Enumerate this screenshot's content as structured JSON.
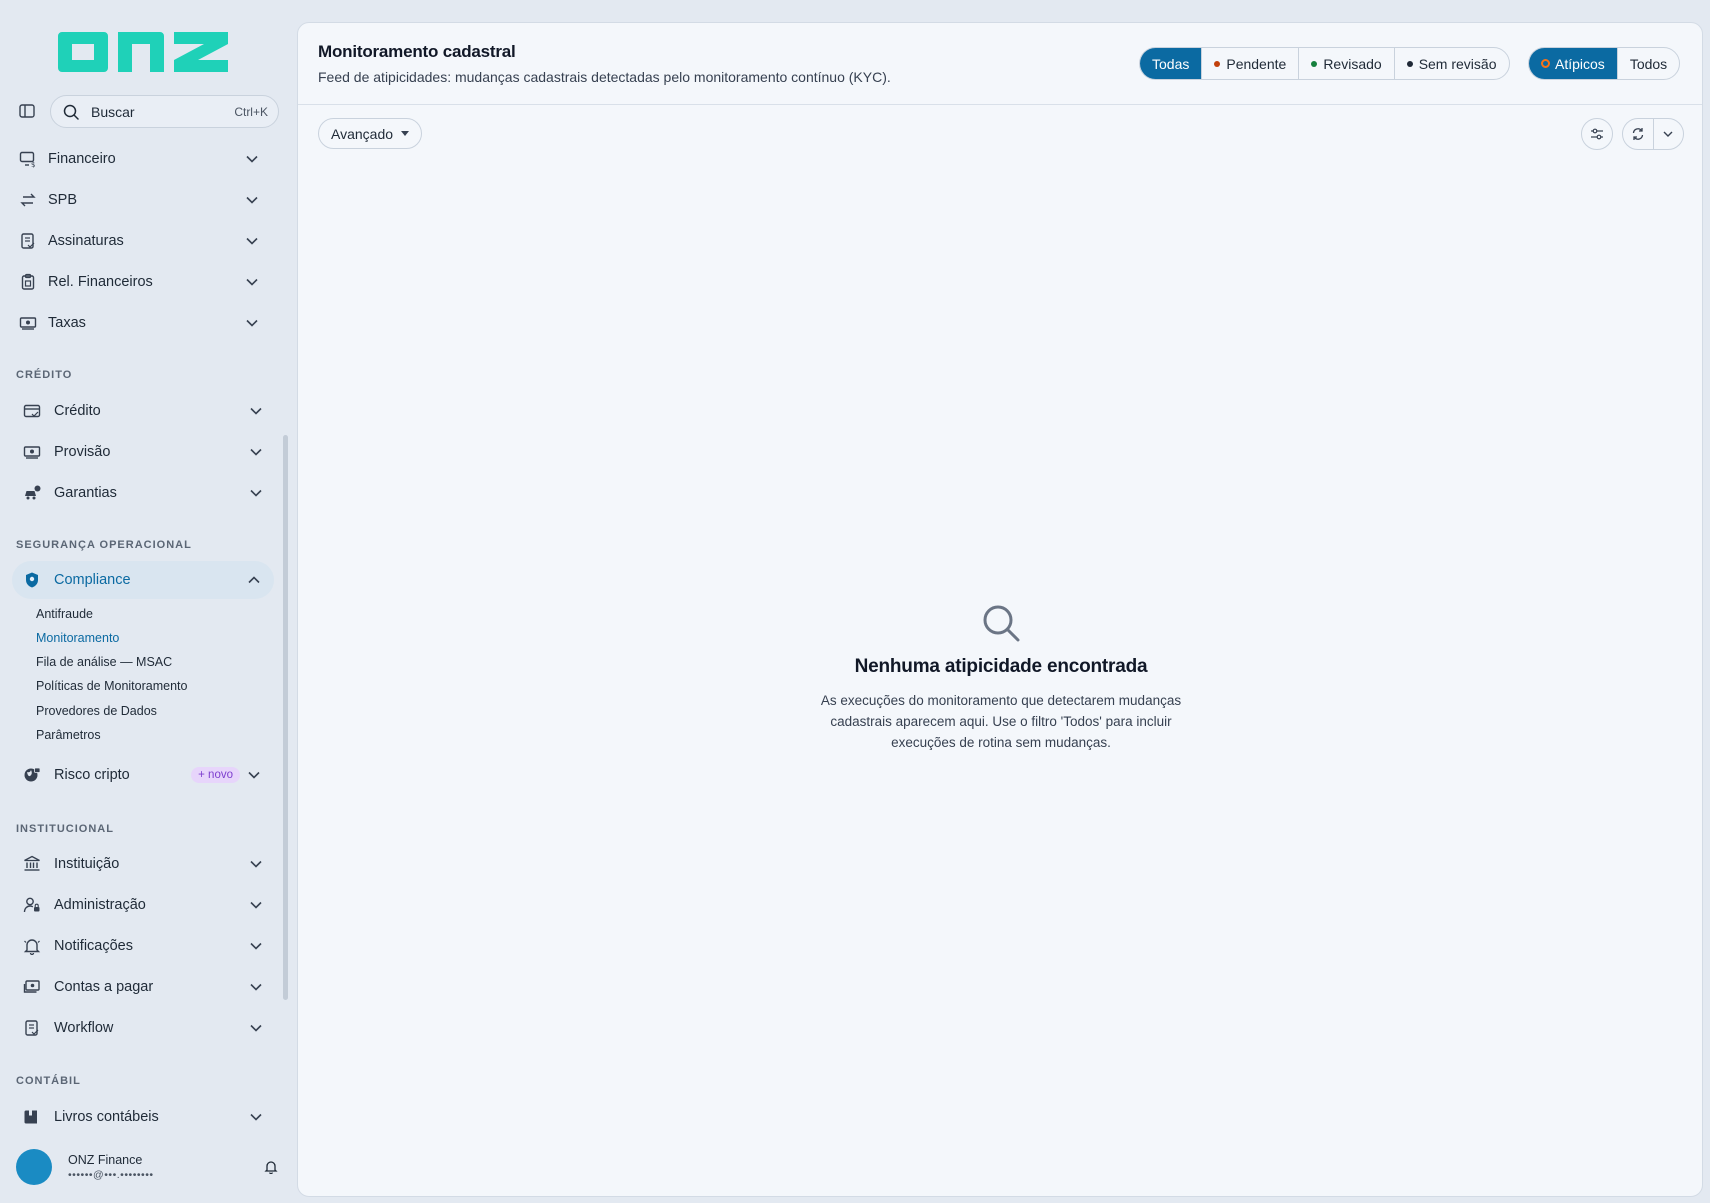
{
  "brand": {
    "logo_text": "onz",
    "accent_color": "#1fd1b8"
  },
  "sidebar": {
    "search": {
      "label": "Buscar",
      "shortcut": "Ctrl+K"
    },
    "items_top": [
      {
        "label": "Financeiro",
        "icon": "monitor-dollar-icon"
      },
      {
        "label": "SPB",
        "icon": "arrows-exchange-icon"
      },
      {
        "label": "Assinaturas",
        "icon": "document-signature-icon"
      },
      {
        "label": "Rel. Financeiros",
        "icon": "clipboard-icon"
      },
      {
        "label": "Taxas",
        "icon": "banknote-icon"
      }
    ],
    "section_credito": "CRÉDITO",
    "items_credito": [
      {
        "label": "Crédito",
        "icon": "card-icon"
      },
      {
        "label": "Provisão",
        "icon": "banknote-icon"
      },
      {
        "label": "Garantias",
        "icon": "car-guarantee-icon"
      }
    ],
    "section_seguranca": "SEGURANÇA OPERACIONAL",
    "compliance": {
      "label": "Compliance",
      "icon": "shield-icon"
    },
    "compliance_sub": [
      "Antifraude",
      "Monitoramento",
      "Fila de análise — MSAC",
      "Políticas de Monitoramento",
      "Provedores de Dados",
      "Parâmetros"
    ],
    "risco": {
      "label": "Risco cripto",
      "badge": "+ novo",
      "icon": "globe-lock-icon"
    },
    "section_institucional": "INSTITUCIONAL",
    "items_institucional": [
      {
        "label": "Instituição",
        "icon": "bank-icon"
      },
      {
        "label": "Administração",
        "icon": "user-lock-icon"
      },
      {
        "label": "Notificações",
        "icon": "bell-icon"
      },
      {
        "label": "Contas a pagar",
        "icon": "bill-icon"
      },
      {
        "label": "Workflow",
        "icon": "document-check-icon"
      }
    ],
    "section_contabil": "CONTÁBIL",
    "livros": {
      "label": "Livros contábeis",
      "icon": "book-icon"
    },
    "user": {
      "name": "ONZ Finance",
      "email": "••••••@•••.••••••••"
    }
  },
  "header": {
    "title": "Monitoramento cadastral",
    "subtitle": "Feed de atipicidades: mudanças cadastrais detectadas pelo monitoramento contínuo (KYC).",
    "status_filters": [
      {
        "label": "Todas",
        "selected": true
      },
      {
        "label": "Pendente",
        "dot_color": "#c2410c"
      },
      {
        "label": "Revisado",
        "dot_color": "#15803d"
      },
      {
        "label": "Sem revisão",
        "dot_color": "#1f2937"
      }
    ],
    "kind_filters": [
      {
        "label": "Atípicos",
        "selected": true
      },
      {
        "label": "Todos"
      }
    ]
  },
  "toolbar": {
    "advanced_label": "Avançado"
  },
  "empty_state": {
    "title": "Nenhuma atipicidade encontrada",
    "text": "As execuções do monitoramento que detectarem mudanças cadastrais aparecem aqui. Use o filtro 'Todos' para incluir execuções de rotina sem mudanças."
  }
}
